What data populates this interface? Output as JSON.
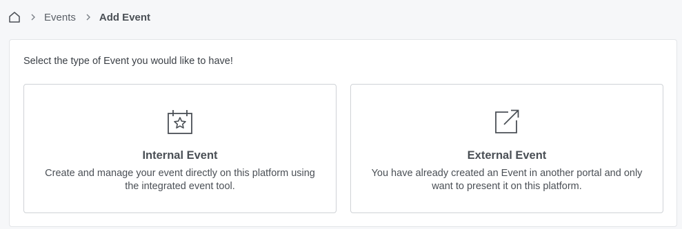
{
  "breadcrumb": {
    "home_icon": "home-icon",
    "separator_icon": "chevron-right-icon",
    "items": [
      "Events",
      "Add Event"
    ]
  },
  "panel": {
    "instruction": "Select the type of Event you would like to have!",
    "cards": [
      {
        "icon": "calendar-star-icon",
        "title": "Internal Event",
        "description": "Create and manage your event directly on this platform using the integrated event tool."
      },
      {
        "icon": "external-link-icon",
        "title": "External Event",
        "description": "You have already created an Event in another portal and only want to present it on this platform."
      }
    ]
  }
}
